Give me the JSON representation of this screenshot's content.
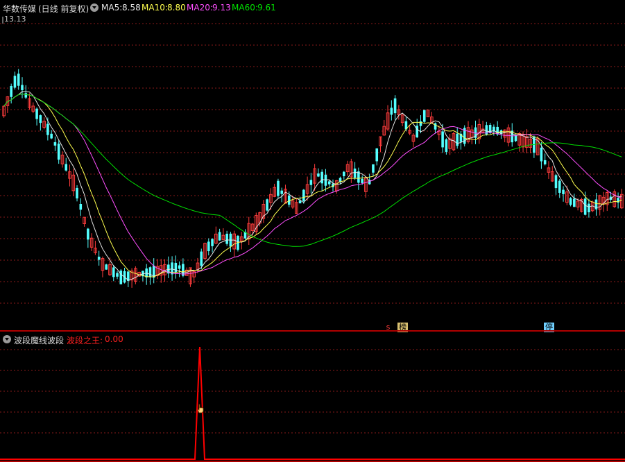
{
  "header": {
    "stock_name": "华数传媒",
    "period": "(日线 前复权)",
    "ma5_label": "MA5:",
    "ma5_value": "8.58",
    "ma10_label": "MA10:",
    "ma10_value": "8.80",
    "ma20_label": "MA20:",
    "ma20_value": "9.13",
    "ma60_label": "MA60:",
    "ma60_value": "9.61",
    "high_marker": "13.13"
  },
  "badges": {
    "s_text": "s",
    "bang_text": "榜",
    "ting_text": "停"
  },
  "indicator": {
    "title": "波段魔线波段",
    "line_label": "波段之王:",
    "line_value": "0.00"
  },
  "colors": {
    "bg": "#000000",
    "up": "#ff3c3c",
    "down": "#54ffff",
    "ma5": "#e6e6e6",
    "ma10": "#ffff4f",
    "ma20": "#ff4fff",
    "ma60": "#00e000",
    "grid": "#8a1a1a",
    "indicator": "#ff0000"
  },
  "chart_data": {
    "type": "candlestick",
    "candle_count": 170,
    "price_high_marker": 13.13,
    "ma_latest": {
      "MA5": 8.58,
      "MA10": 8.8,
      "MA20": 9.13,
      "MA60": 9.61
    },
    "indicator_series": {
      "name": "波段之王",
      "latest": 0.0,
      "spike_values": [
        0,
        1,
        0
      ]
    }
  }
}
